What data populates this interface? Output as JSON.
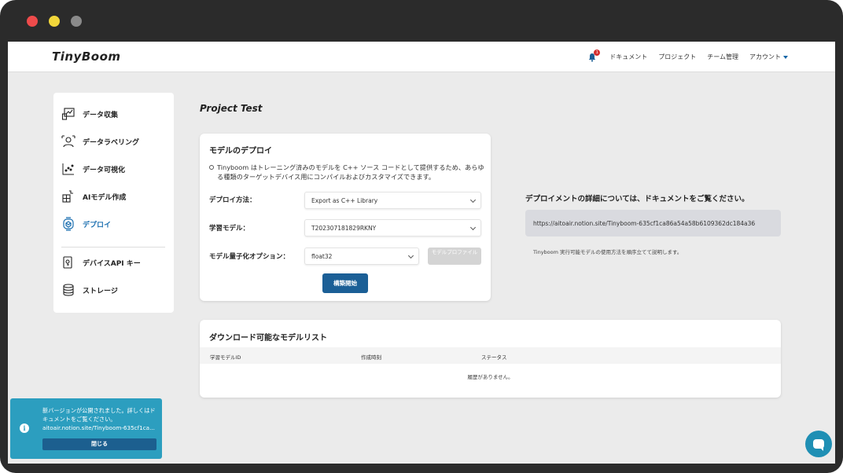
{
  "window": {
    "controls": [
      "close",
      "minimize",
      "zoom"
    ]
  },
  "header": {
    "logo": "TinyBoom",
    "notification_count": "1",
    "nav": {
      "docs": "ドキュメント",
      "projects": "プロジェクト",
      "team": "チーム管理",
      "account": "アカウント"
    }
  },
  "sidebar": {
    "items": [
      {
        "label": "データ収集",
        "icon": "data-collection-icon"
      },
      {
        "label": "データラベリング",
        "icon": "data-labeling-icon"
      },
      {
        "label": "データ可視化",
        "icon": "data-visualization-icon"
      },
      {
        "label": "AIモデル作成",
        "icon": "ai-model-icon"
      },
      {
        "label": "デプロイ",
        "icon": "deploy-icon",
        "active": true
      },
      {
        "label": "デバイスAPI キー",
        "icon": "device-api-key-icon"
      },
      {
        "label": "ストレージ",
        "icon": "storage-icon"
      }
    ]
  },
  "main": {
    "page_title": "Project Test",
    "deploy_card": {
      "title": "モデルのデプロイ",
      "description": "Tinyboom はトレーニング済みのモデルを C++ ソース コードとして提供するため、あらゆる種類のターゲットデバイス用にコンパイルおよびカスタマイズできます。",
      "deploy_method_label": "デプロイ方法：",
      "deploy_method_value": "Export as C++ Library",
      "model_label": "学習モデル：",
      "model_value": "T202307181829RKNY",
      "quant_label": "モデル量子化オプション：",
      "quant_value": "float32",
      "profile_button": "モデルプロファイル",
      "build_button": "構築開始"
    },
    "info": {
      "title": "デプロイメントの詳細については、ドキュメントをご覧ください。",
      "url": "https://aitoair.notion.site/Tinyboom-635cf1ca86a54a58b6109362dc184a36",
      "note": "Tinyboom 実行可能モデルの使用方法を順序立てて説明します。"
    },
    "model_list": {
      "title": "ダウンロード可能なモデルリスト",
      "columns": [
        "学習モデルID",
        "作成時刻",
        "ステータス"
      ],
      "empty_text": "履歴がありません。"
    }
  },
  "toast": {
    "message": "新バージョンが公開されました。詳しくはドキュメントをご覧ください。",
    "link": "aitoair.notion.site/Tinyboom-635cf1ca...",
    "close_button": "閉じる"
  },
  "colors": {
    "accent": "#1b5f96",
    "active_nav": "#1b6fb0",
    "toast_bg": "#2c9ebf",
    "chat_bg": "#1f8fb4"
  }
}
